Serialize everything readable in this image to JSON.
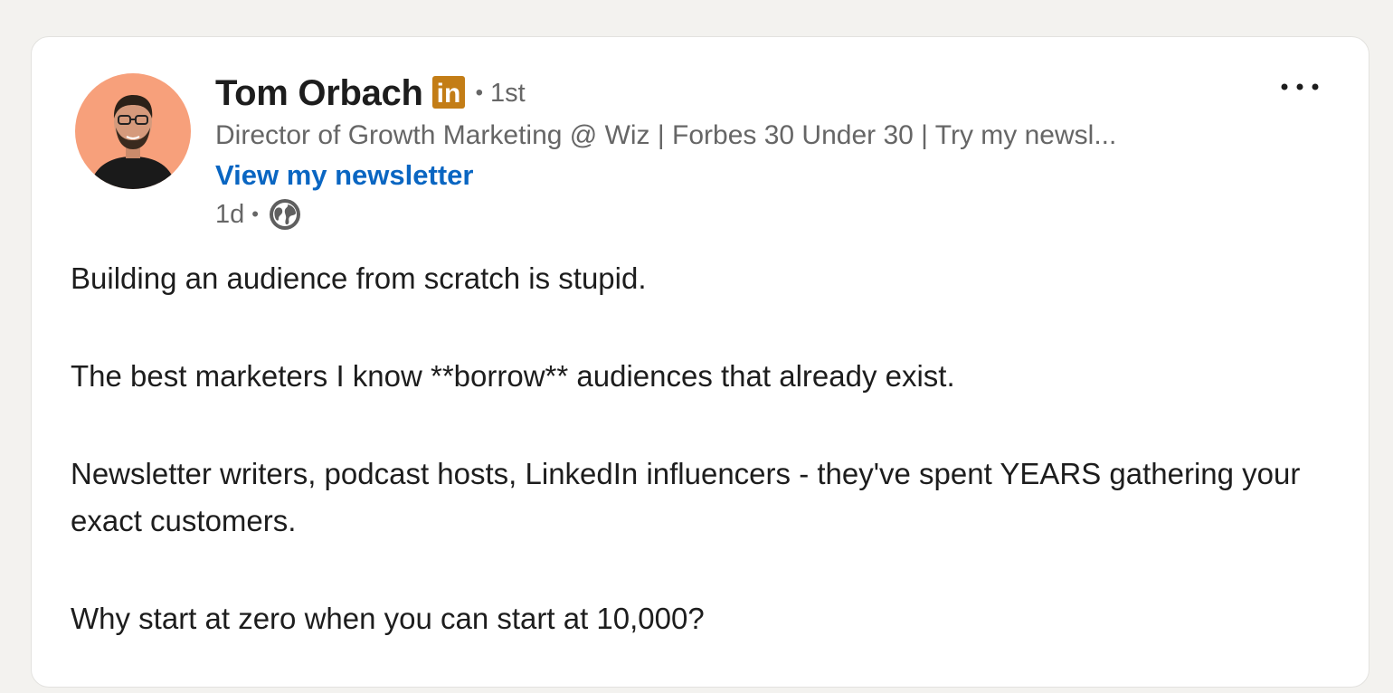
{
  "author": {
    "name": "Tom Orbach",
    "badge": "in",
    "degree": "1st",
    "headline": "Director of Growth Marketing @ Wiz | Forbes 30 Under 30 | Try my newsl...",
    "cta_link": "View my newsletter",
    "avatar_background": "#f7a07b"
  },
  "meta": {
    "time": "1d",
    "visibility_icon": "globe-icon"
  },
  "post": {
    "paragraphs": [
      "Building an audience from scratch is stupid.",
      "The best marketers I know **borrow** audiences that already exist.",
      "Newsletter writers, podcast hosts, LinkedIn influencers - they've spent YEARS gathering your exact customers.",
      "Why start at zero when you can start at 10,000?"
    ]
  },
  "colors": {
    "page_bg": "#f3f2ef",
    "card_bg": "#ffffff",
    "link": "#0a66c2",
    "badge": "#c37d16",
    "text_primary": "#1d1d1d",
    "text_secondary": "#666666"
  }
}
